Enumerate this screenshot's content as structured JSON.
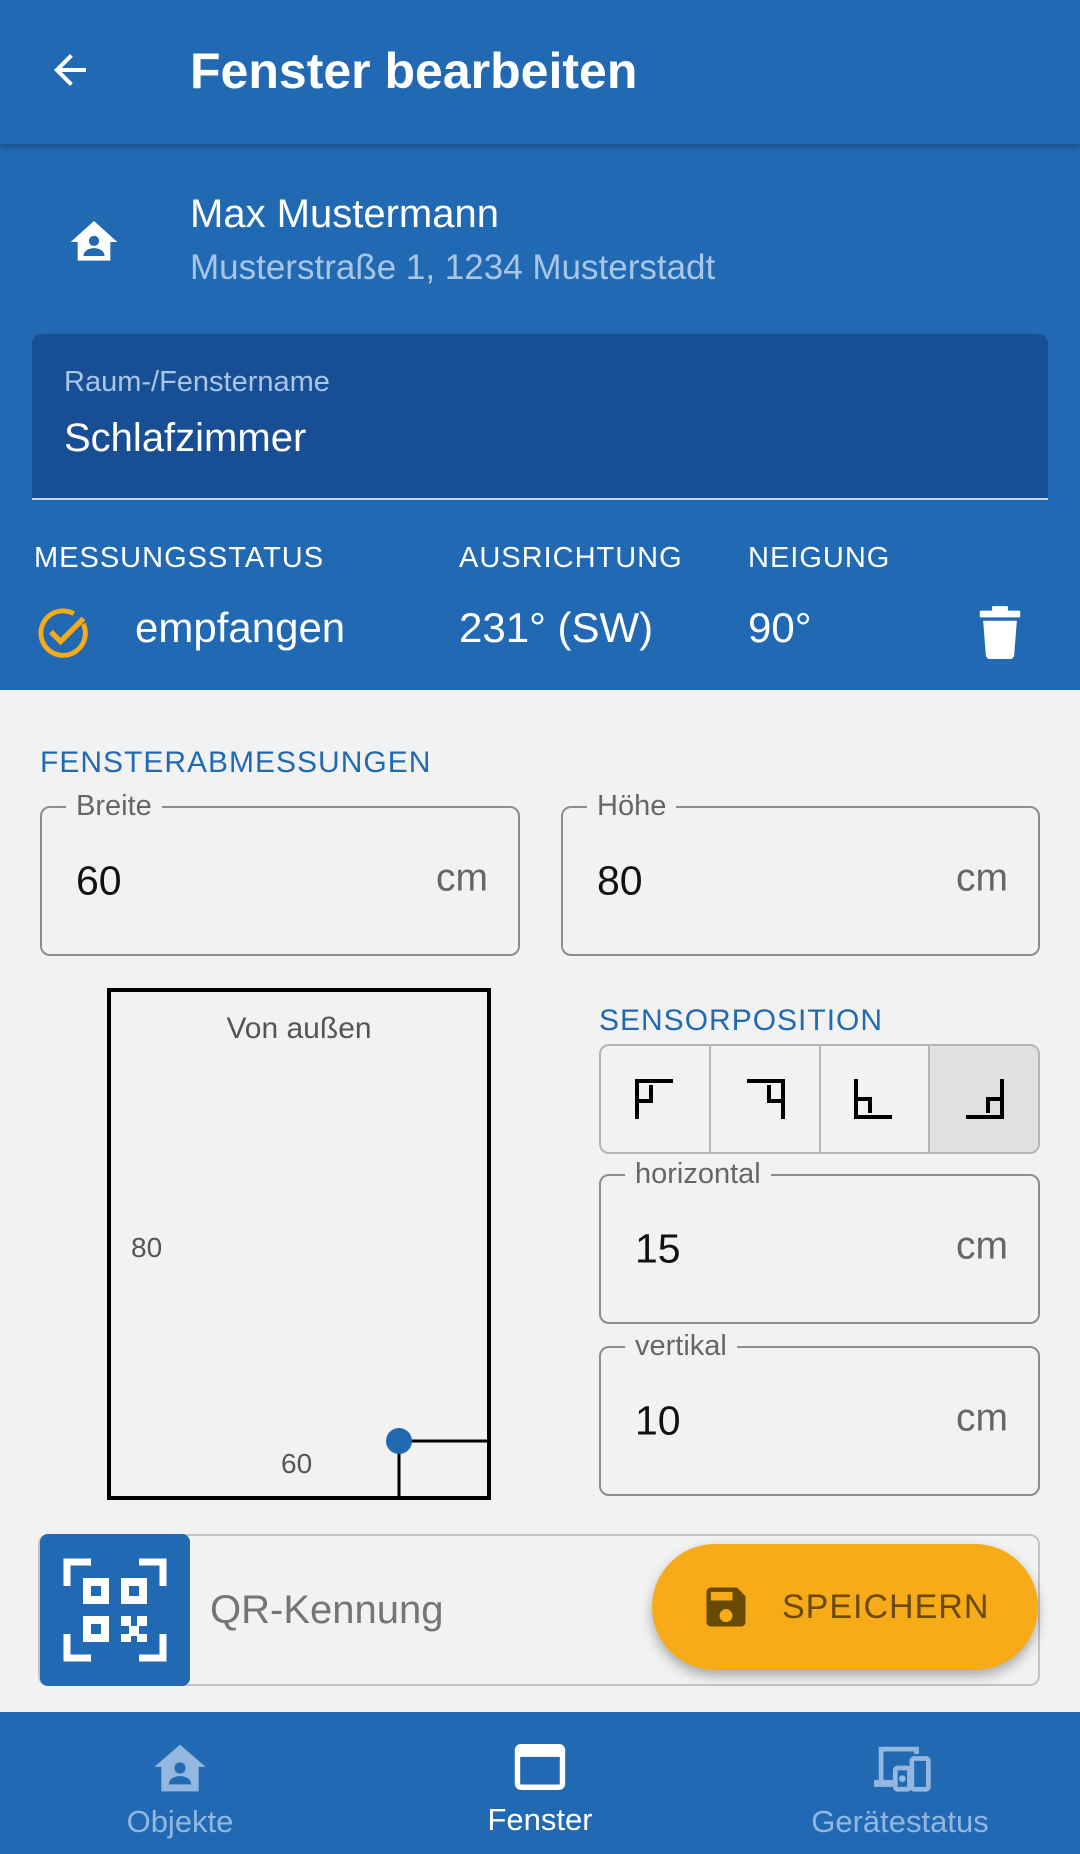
{
  "appbar": {
    "title": "Fenster bearbeiten"
  },
  "owner": {
    "name": "Max Mustermann",
    "address": "Musterstraße 1, 1234 Musterstadt"
  },
  "room_field": {
    "label": "Raum-/Fenstername",
    "value": "Schlafzimmer"
  },
  "status": {
    "measurement_header": "MESSUNGSSTATUS",
    "measurement_value": "empfangen",
    "orientation_header": "AUSRICHTUNG",
    "orientation_value": "231° (SW)",
    "tilt_header": "NEIGUNG",
    "tilt_value": "90°"
  },
  "dimensions": {
    "section_title": "FENSTERABMESSUNGEN",
    "width": {
      "label": "Breite",
      "value": "60",
      "unit": "cm"
    },
    "height": {
      "label": "Höhe",
      "value": "80",
      "unit": "cm"
    }
  },
  "diagram": {
    "caption": "Von außen",
    "height_label": "80",
    "width_label": "60"
  },
  "sensor": {
    "section_title": "SENSORPOSITION",
    "positions": [
      "top-left",
      "top-right",
      "bottom-left",
      "bottom-right"
    ],
    "selected_position": "bottom-right",
    "horizontal": {
      "label": "horizontal",
      "value": "15",
      "unit": "cm"
    },
    "vertical": {
      "label": "vertikal",
      "value": "10",
      "unit": "cm"
    }
  },
  "qr": {
    "placeholder": "QR-Kennung",
    "icon": "qr-code-scan-icon"
  },
  "fab": {
    "label": "SPEICHERN",
    "icon": "save-icon"
  },
  "nav": [
    {
      "label": "Objekte",
      "icon": "home-account-icon",
      "active": false
    },
    {
      "label": "Fenster",
      "icon": "window-icon",
      "active": true
    },
    {
      "label": "Gerätestatus",
      "icon": "devices-icon",
      "active": false
    }
  ],
  "colors": {
    "primary": "#2169b3",
    "primary_dark": "#184f94",
    "accent": "#f7ab18",
    "status_check": "#f7ab18"
  }
}
